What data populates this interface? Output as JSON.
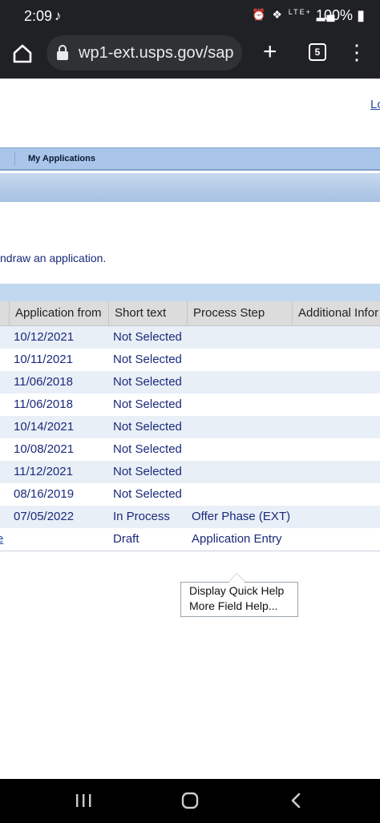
{
  "status_bar": {
    "time": "2:09",
    "app_icon": "tiktok-icon",
    "network": "LTE+",
    "battery": "100%"
  },
  "browser": {
    "url": "wp1-ext.usps.gov/sap",
    "tab_count": "5",
    "icons": [
      "home-icon",
      "lock-icon",
      "plus-icon",
      "tabs-icon",
      "kebab-menu-icon"
    ]
  },
  "header": {
    "logout_link": "Lo"
  },
  "nav": {
    "left_crumb": ":",
    "my_applications": "My Applications"
  },
  "instruction": "ndraw an application.",
  "table": {
    "columns": [
      "Application from",
      "Short text",
      "Process Step",
      "Additional Infor"
    ],
    "rows": [
      {
        "date": "10/12/2021",
        "short_text": "Not Selected",
        "process_step": "",
        "extra": ""
      },
      {
        "date": "10/11/2021",
        "short_text": "Not Selected",
        "process_step": "",
        "extra": ""
      },
      {
        "date": "11/06/2018",
        "short_text": "Not Selected",
        "process_step": "",
        "extra": ""
      },
      {
        "date": "11/06/2018",
        "short_text": "Not Selected",
        "process_step": "",
        "extra": ""
      },
      {
        "date": "10/14/2021",
        "short_text": "Not Selected",
        "process_step": "",
        "extra": ""
      },
      {
        "date": "10/08/2021",
        "short_text": "Not Selected",
        "process_step": "",
        "extra": ""
      },
      {
        "date": "11/12/2021",
        "short_text": "Not Selected",
        "process_step": "",
        "extra": ""
      },
      {
        "date": "08/16/2019",
        "short_text": "Not Selected",
        "process_step": "",
        "extra": ""
      },
      {
        "date": "07/05/2022",
        "short_text": "In Process",
        "process_step": "Offer Phase (EXT)",
        "extra": ""
      },
      {
        "date": "",
        "short_text": "Draft",
        "process_step": "Application Entry",
        "extra": "",
        "left_link": "e"
      }
    ]
  },
  "help_popup": {
    "item1": "Display Quick Help",
    "item2": "More Field Help..."
  },
  "android_nav": [
    "recents-icon",
    "home-circle-icon",
    "back-chevron-icon"
  ],
  "colors": {
    "browser_bar": "#202124",
    "nav_band": "#a9c6ea",
    "link_text": "#1a2a7a",
    "row_alt": "#e9eff7"
  }
}
